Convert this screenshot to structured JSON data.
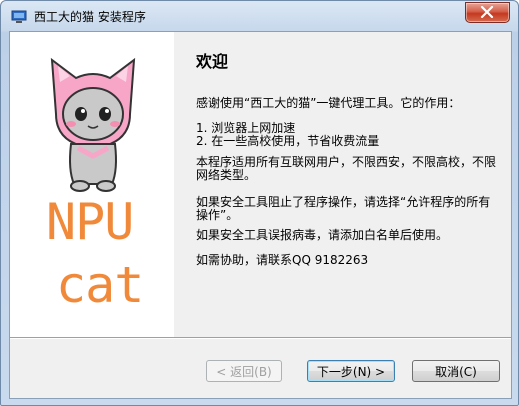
{
  "window": {
    "title": "西工大的猫 安装程序"
  },
  "icons": {
    "app": "installer-icon",
    "close": "close-icon"
  },
  "left_panel": {
    "logo_line1": "NPU",
    "logo_line2": "cat",
    "logo_color": "#f08a3a"
  },
  "content": {
    "heading": "欢迎",
    "intro": "感谢使用“西工大的猫”一键代理工具。它的作用：",
    "features": [
      "1.  浏览器上网加速",
      "2.  在一些高校使用，节省收费流量"
    ],
    "scope": "本程序适用所有互联网用户，不限西安，不限高校，不限网络类型。",
    "security_block": "如果安全工具阻止了程序操作，请选择“允许程序的所有操作”。",
    "false_positive": "如果安全工具误报病毒，请添加白名单后使用。",
    "help": "如需协助，请联系QQ 9182263"
  },
  "buttons": {
    "back": "< 返回(B)",
    "next": "下一步(N) >",
    "cancel": "取消(C)"
  }
}
